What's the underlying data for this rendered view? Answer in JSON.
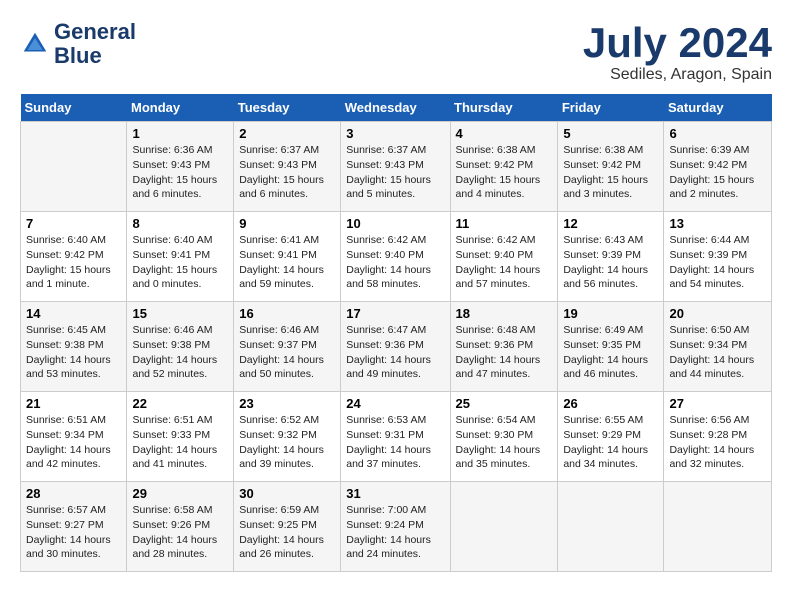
{
  "header": {
    "logo_line1": "General",
    "logo_line2": "Blue",
    "month": "July 2024",
    "location": "Sediles, Aragon, Spain"
  },
  "days_of_week": [
    "Sunday",
    "Monday",
    "Tuesday",
    "Wednesday",
    "Thursday",
    "Friday",
    "Saturday"
  ],
  "weeks": [
    [
      {
        "num": "",
        "sunrise": "",
        "sunset": "",
        "daylight": ""
      },
      {
        "num": "1",
        "sunrise": "Sunrise: 6:36 AM",
        "sunset": "Sunset: 9:43 PM",
        "daylight": "Daylight: 15 hours and 6 minutes."
      },
      {
        "num": "2",
        "sunrise": "Sunrise: 6:37 AM",
        "sunset": "Sunset: 9:43 PM",
        "daylight": "Daylight: 15 hours and 6 minutes."
      },
      {
        "num": "3",
        "sunrise": "Sunrise: 6:37 AM",
        "sunset": "Sunset: 9:43 PM",
        "daylight": "Daylight: 15 hours and 5 minutes."
      },
      {
        "num": "4",
        "sunrise": "Sunrise: 6:38 AM",
        "sunset": "Sunset: 9:42 PM",
        "daylight": "Daylight: 15 hours and 4 minutes."
      },
      {
        "num": "5",
        "sunrise": "Sunrise: 6:38 AM",
        "sunset": "Sunset: 9:42 PM",
        "daylight": "Daylight: 15 hours and 3 minutes."
      },
      {
        "num": "6",
        "sunrise": "Sunrise: 6:39 AM",
        "sunset": "Sunset: 9:42 PM",
        "daylight": "Daylight: 15 hours and 2 minutes."
      }
    ],
    [
      {
        "num": "7",
        "sunrise": "Sunrise: 6:40 AM",
        "sunset": "Sunset: 9:42 PM",
        "daylight": "Daylight: 15 hours and 1 minute."
      },
      {
        "num": "8",
        "sunrise": "Sunrise: 6:40 AM",
        "sunset": "Sunset: 9:41 PM",
        "daylight": "Daylight: 15 hours and 0 minutes."
      },
      {
        "num": "9",
        "sunrise": "Sunrise: 6:41 AM",
        "sunset": "Sunset: 9:41 PM",
        "daylight": "Daylight: 14 hours and 59 minutes."
      },
      {
        "num": "10",
        "sunrise": "Sunrise: 6:42 AM",
        "sunset": "Sunset: 9:40 PM",
        "daylight": "Daylight: 14 hours and 58 minutes."
      },
      {
        "num": "11",
        "sunrise": "Sunrise: 6:42 AM",
        "sunset": "Sunset: 9:40 PM",
        "daylight": "Daylight: 14 hours and 57 minutes."
      },
      {
        "num": "12",
        "sunrise": "Sunrise: 6:43 AM",
        "sunset": "Sunset: 9:39 PM",
        "daylight": "Daylight: 14 hours and 56 minutes."
      },
      {
        "num": "13",
        "sunrise": "Sunrise: 6:44 AM",
        "sunset": "Sunset: 9:39 PM",
        "daylight": "Daylight: 14 hours and 54 minutes."
      }
    ],
    [
      {
        "num": "14",
        "sunrise": "Sunrise: 6:45 AM",
        "sunset": "Sunset: 9:38 PM",
        "daylight": "Daylight: 14 hours and 53 minutes."
      },
      {
        "num": "15",
        "sunrise": "Sunrise: 6:46 AM",
        "sunset": "Sunset: 9:38 PM",
        "daylight": "Daylight: 14 hours and 52 minutes."
      },
      {
        "num": "16",
        "sunrise": "Sunrise: 6:46 AM",
        "sunset": "Sunset: 9:37 PM",
        "daylight": "Daylight: 14 hours and 50 minutes."
      },
      {
        "num": "17",
        "sunrise": "Sunrise: 6:47 AM",
        "sunset": "Sunset: 9:36 PM",
        "daylight": "Daylight: 14 hours and 49 minutes."
      },
      {
        "num": "18",
        "sunrise": "Sunrise: 6:48 AM",
        "sunset": "Sunset: 9:36 PM",
        "daylight": "Daylight: 14 hours and 47 minutes."
      },
      {
        "num": "19",
        "sunrise": "Sunrise: 6:49 AM",
        "sunset": "Sunset: 9:35 PM",
        "daylight": "Daylight: 14 hours and 46 minutes."
      },
      {
        "num": "20",
        "sunrise": "Sunrise: 6:50 AM",
        "sunset": "Sunset: 9:34 PM",
        "daylight": "Daylight: 14 hours and 44 minutes."
      }
    ],
    [
      {
        "num": "21",
        "sunrise": "Sunrise: 6:51 AM",
        "sunset": "Sunset: 9:34 PM",
        "daylight": "Daylight: 14 hours and 42 minutes."
      },
      {
        "num": "22",
        "sunrise": "Sunrise: 6:51 AM",
        "sunset": "Sunset: 9:33 PM",
        "daylight": "Daylight: 14 hours and 41 minutes."
      },
      {
        "num": "23",
        "sunrise": "Sunrise: 6:52 AM",
        "sunset": "Sunset: 9:32 PM",
        "daylight": "Daylight: 14 hours and 39 minutes."
      },
      {
        "num": "24",
        "sunrise": "Sunrise: 6:53 AM",
        "sunset": "Sunset: 9:31 PM",
        "daylight": "Daylight: 14 hours and 37 minutes."
      },
      {
        "num": "25",
        "sunrise": "Sunrise: 6:54 AM",
        "sunset": "Sunset: 9:30 PM",
        "daylight": "Daylight: 14 hours and 35 minutes."
      },
      {
        "num": "26",
        "sunrise": "Sunrise: 6:55 AM",
        "sunset": "Sunset: 9:29 PM",
        "daylight": "Daylight: 14 hours and 34 minutes."
      },
      {
        "num": "27",
        "sunrise": "Sunrise: 6:56 AM",
        "sunset": "Sunset: 9:28 PM",
        "daylight": "Daylight: 14 hours and 32 minutes."
      }
    ],
    [
      {
        "num": "28",
        "sunrise": "Sunrise: 6:57 AM",
        "sunset": "Sunset: 9:27 PM",
        "daylight": "Daylight: 14 hours and 30 minutes."
      },
      {
        "num": "29",
        "sunrise": "Sunrise: 6:58 AM",
        "sunset": "Sunset: 9:26 PM",
        "daylight": "Daylight: 14 hours and 28 minutes."
      },
      {
        "num": "30",
        "sunrise": "Sunrise: 6:59 AM",
        "sunset": "Sunset: 9:25 PM",
        "daylight": "Daylight: 14 hours and 26 minutes."
      },
      {
        "num": "31",
        "sunrise": "Sunrise: 7:00 AM",
        "sunset": "Sunset: 9:24 PM",
        "daylight": "Daylight: 14 hours and 24 minutes."
      },
      {
        "num": "",
        "sunrise": "",
        "sunset": "",
        "daylight": ""
      },
      {
        "num": "",
        "sunrise": "",
        "sunset": "",
        "daylight": ""
      },
      {
        "num": "",
        "sunrise": "",
        "sunset": "",
        "daylight": ""
      }
    ]
  ]
}
